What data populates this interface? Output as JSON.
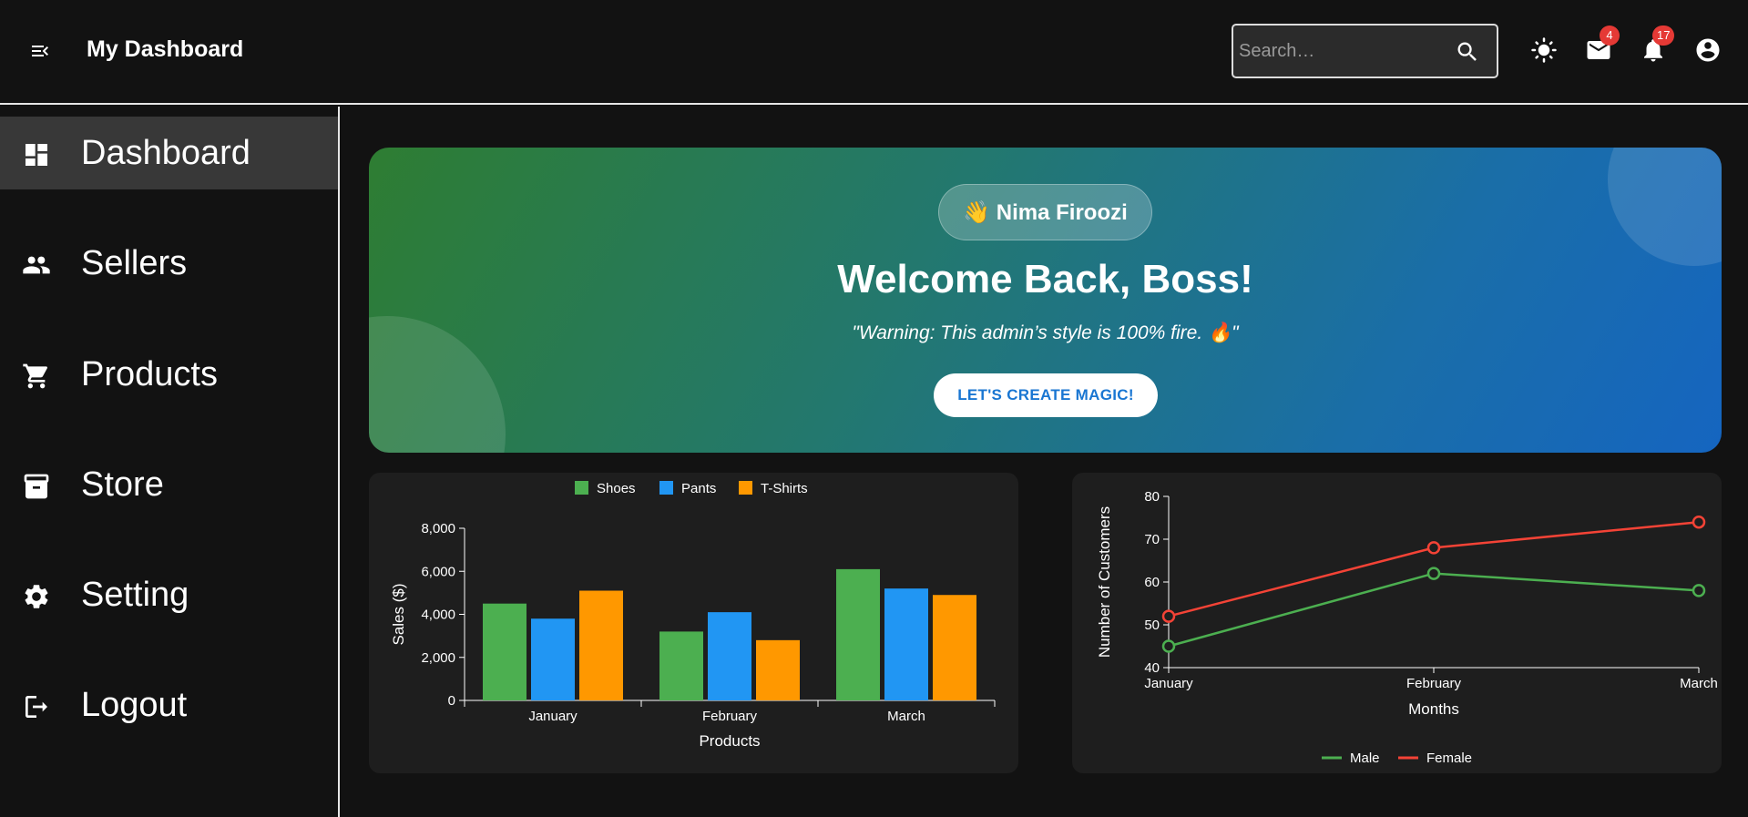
{
  "header": {
    "title": "My Dashboard",
    "search_placeholder": "Search…",
    "mail_count": "4",
    "notification_count": "17"
  },
  "sidebar": {
    "items": [
      {
        "label": "Dashboard",
        "icon": "dashboard-icon",
        "active": true
      },
      {
        "label": "Sellers",
        "icon": "people-icon"
      },
      {
        "label": "Products",
        "icon": "cart-icon"
      },
      {
        "label": "Store",
        "icon": "archive-icon"
      },
      {
        "label": "Setting",
        "icon": "gear-icon"
      },
      {
        "label": "Logout",
        "icon": "logout-icon"
      }
    ]
  },
  "hero": {
    "user_name": "👋 Nima Firoozi",
    "title": "Welcome Back, Boss!",
    "quote": "\"Warning: This admin’s style is 100% fire. 🔥\"",
    "cta_label": "LET'S CREATE MAGIC!"
  },
  "colors": {
    "green": "#4caf50",
    "blue": "#2196f3",
    "orange": "#ff9800",
    "red": "#f44336",
    "badge": "#e53935"
  },
  "chart_data": [
    {
      "type": "bar",
      "categories": [
        "January",
        "February",
        "March"
      ],
      "series": [
        {
          "name": "Shoes",
          "values": [
            4500,
            3200,
            6100
          ]
        },
        {
          "name": "Pants",
          "values": [
            3800,
            4100,
            5200
          ]
        },
        {
          "name": "T-Shirts",
          "values": [
            5100,
            2800,
            4900
          ]
        }
      ],
      "xlabel": "Products",
      "ylabel": "Sales ($)",
      "ylim": [
        0,
        8000
      ],
      "yticks": [
        "0",
        "2,000",
        "4,000",
        "6,000",
        "8,000"
      ],
      "legend": "top-center"
    },
    {
      "type": "line",
      "x": [
        "January",
        "February",
        "March"
      ],
      "series": [
        {
          "name": "Male",
          "values": [
            45,
            62,
            58
          ]
        },
        {
          "name": "Female",
          "values": [
            52,
            68,
            74
          ]
        }
      ],
      "xlabel": "Months",
      "ylabel": "Number of Customers",
      "ylim": [
        40,
        80
      ],
      "yticks": [
        "40",
        "50",
        "60",
        "70",
        "80"
      ],
      "legend": "bottom-center"
    }
  ]
}
